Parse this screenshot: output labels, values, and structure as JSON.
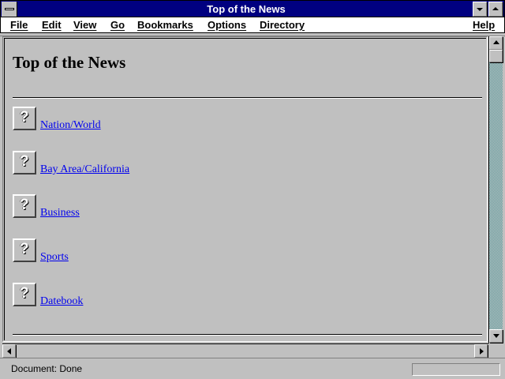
{
  "window": {
    "title": "Top of the News"
  },
  "menu": {
    "items": [
      {
        "label": "File"
      },
      {
        "label": "Edit"
      },
      {
        "label": "View"
      },
      {
        "label": "Go"
      },
      {
        "label": "Bookmarks"
      },
      {
        "label": "Options"
      },
      {
        "label": "Directory"
      }
    ],
    "help": "Help"
  },
  "page": {
    "heading": "Top of the News",
    "links": [
      {
        "label": "Nation/World",
        "icon": "broken-image-icon"
      },
      {
        "label": "Bay Area/California",
        "icon": "broken-image-icon"
      },
      {
        "label": "Business",
        "icon": "broken-image-icon"
      },
      {
        "label": "Sports",
        "icon": "broken-image-icon"
      },
      {
        "label": "Datebook",
        "icon": "broken-image-icon"
      }
    ]
  },
  "status": {
    "text": "Document: Done"
  },
  "colors": {
    "titlebar": "#000080",
    "link": "#0000ee",
    "chrome": "#c0c0c0"
  }
}
